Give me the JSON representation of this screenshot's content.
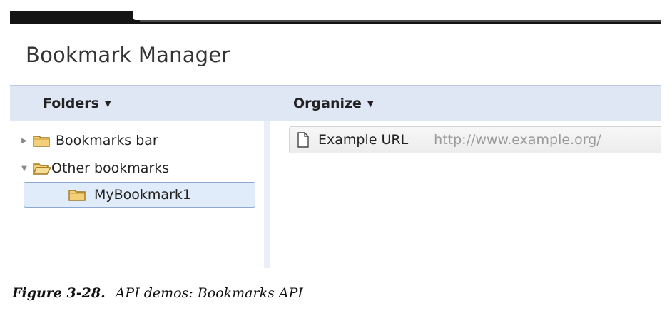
{
  "window": {
    "title": "Bookmark Manager"
  },
  "toolbar": {
    "folders_label": "Folders",
    "organize_label": "Organize"
  },
  "tree": {
    "items": [
      {
        "label": "Bookmarks bar",
        "expanded": false,
        "icon": "folder-icon"
      },
      {
        "label": "Other bookmarks",
        "expanded": true,
        "icon": "folder-open-icon"
      },
      {
        "label": "MyBookmark1",
        "selected": true,
        "icon": "folder-icon"
      }
    ]
  },
  "bookmarks": [
    {
      "title": "Example URL",
      "url": "http://www.example.org/",
      "icon": "page-icon"
    }
  ],
  "caption": {
    "number": "Figure 3-28.",
    "text": "API demos: Bookmarks API"
  },
  "colors": {
    "toolbar_bg": "#dfe7f5",
    "selection_bg": "#e1ecfa",
    "selection_border": "#8ea8cf",
    "folder_fill": "#f3d078",
    "folder_stroke": "#a0761e"
  }
}
